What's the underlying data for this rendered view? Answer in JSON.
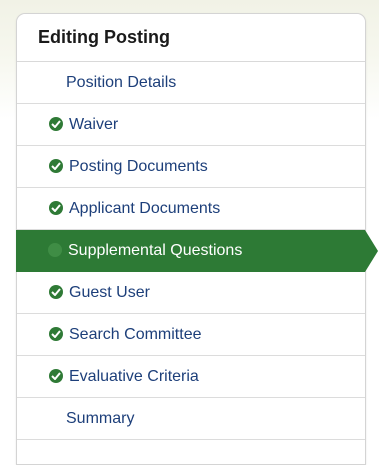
{
  "panel": {
    "title": "Editing Posting"
  },
  "nav": {
    "items": [
      {
        "label": "Position Details",
        "status": "none"
      },
      {
        "label": "Waiver",
        "status": "complete"
      },
      {
        "label": "Posting Documents",
        "status": "complete"
      },
      {
        "label": "Applicant Documents",
        "status": "complete"
      },
      {
        "label": "Supplemental Questions",
        "status": "active"
      },
      {
        "label": "Guest User",
        "status": "complete"
      },
      {
        "label": "Search Committee",
        "status": "complete"
      },
      {
        "label": "Evaluative Criteria",
        "status": "complete"
      },
      {
        "label": "Summary",
        "status": "none"
      }
    ]
  },
  "colors": {
    "accent_green": "#2d7a35",
    "link_blue": "#1d3f7a"
  },
  "icons": {
    "complete": "check-circle-icon"
  }
}
